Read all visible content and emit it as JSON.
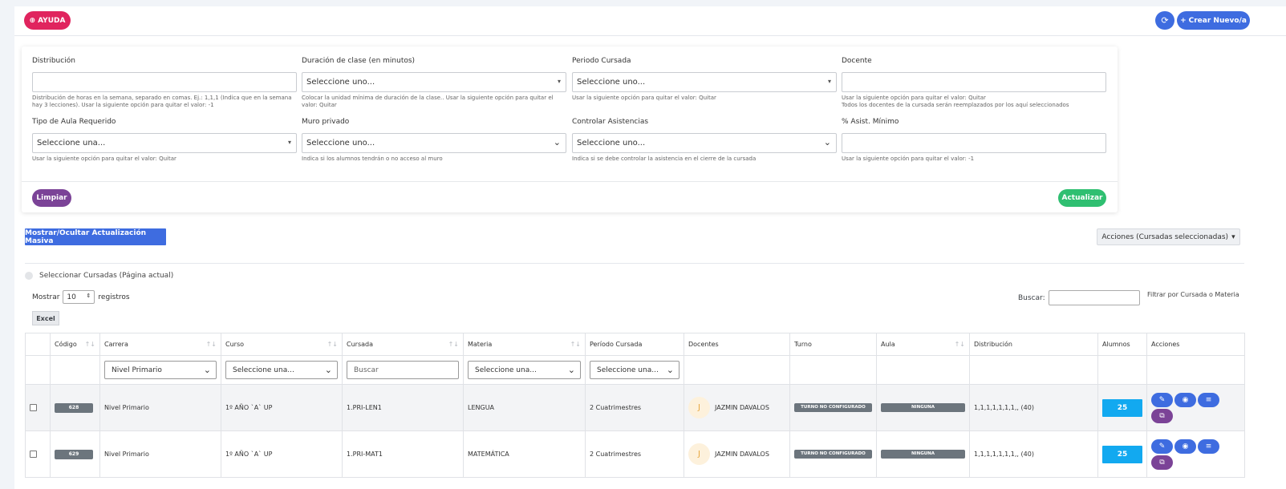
{
  "topbar": {
    "help_label": "AYUDA",
    "help_icon": "lifebuoy-icon",
    "refresh_icon": "refresh-icon",
    "create_label": "Crear Nuevo/a"
  },
  "form": {
    "distribucion": {
      "label": "Distribución",
      "value": "",
      "hint": "Distribución de horas en la semana, separado en comas. Ej.: 1,1,1 (Indica que en la semana hay 3 lecciones). Usar la siguiente opción para quitar el valor: -1"
    },
    "duracion": {
      "label": "Duración de clase (en minutos)",
      "value": "Seleccione uno...",
      "hint": "Colocar la unidad mínima de duración de la clase.. Usar la siguiente opción para quitar el valor: Quitar"
    },
    "periodo": {
      "label": "Periodo Cursada",
      "value": "Seleccione uno...",
      "hint": "Usar la siguiente opción para quitar el valor: Quitar"
    },
    "docente": {
      "label": "Docente",
      "value": "",
      "hint_1": "Usar la siguiente opción para quitar el valor: Quitar",
      "hint_2": "Todos los docentes de la cursada serán reemplazados por los aquí seleccionados"
    },
    "tipo_aula": {
      "label": "Tipo de Aula Requerido",
      "value": "Seleccione una...",
      "hint": "Usar la siguiente opción para quitar el valor: Quitar"
    },
    "muro": {
      "label": "Muro privado",
      "value": "Seleccione uno...",
      "hint": "Indica si los alumnos tendrán o no acceso al muro"
    },
    "asistencias": {
      "label": "Controlar Asistencias",
      "value": "Seleccione uno...",
      "hint": "Indica si se debe controlar la asistencia en el cierre de la cursada"
    },
    "asist_min": {
      "label": "% Asist. Mínimo",
      "value": "",
      "hint": "Usar la siguiente opción para quitar el valor: -1"
    },
    "clear_label": "Limpiar",
    "update_label": "Actualizar"
  },
  "toolbar": {
    "mass_update_label": "Mostrar/Ocultar Actualización Masiva",
    "actions_label": "Acciones (Cursadas seleccionadas)",
    "select_all_label": "Seleccionar Cursadas (Página actual)",
    "show_label": "Mostrar",
    "page_size": "10",
    "records_label": "registros",
    "excel_label": "Excel",
    "search_label": "Buscar:",
    "search_value": "",
    "filter_hint": "Filtrar por Cursada o Materia"
  },
  "table": {
    "headers": [
      "Código",
      "Carrera",
      "Curso",
      "Cursada",
      "Materia",
      "Período Cursada",
      "Docentes",
      "Turno",
      "Aula",
      "Distribución",
      "Alumnos",
      "Acciones"
    ],
    "filters": {
      "carrera": "Nivel Primario",
      "curso": "Seleccione una...",
      "cursada_placeholder": "Buscar",
      "materia": "Seleccione una...",
      "periodo": "Seleccione una..."
    },
    "rows": [
      {
        "codigo": "628",
        "carrera": "Nivel Primario",
        "curso": "1º AÑO `A` UP",
        "cursada": "1.PRI-LEN1",
        "materia": "LENGUA",
        "periodo": "2 Cuatrimestres",
        "docente_initial": "J",
        "docente": "JAZMIN DAVALOS",
        "turno": "TURNO NO CONFIGURADO",
        "aula": "NINGUNA",
        "distribucion": "1,1,1,1,1,1,1,, (40)",
        "alumnos": "25"
      },
      {
        "codigo": "629",
        "carrera": "Nivel Primario",
        "curso": "1º AÑO `A` UP",
        "cursada": "1.PRI-MAT1",
        "materia": "MATEMÁTICA",
        "periodo": "2 Cuatrimestres",
        "docente_initial": "J",
        "docente": "JAZMIN DAVALOS",
        "turno": "TURNO NO CONFIGURADO",
        "aula": "NINGUNA",
        "distribucion": "1,1,1,1,1,1,1,, (40)",
        "alumnos": "25"
      }
    ]
  }
}
